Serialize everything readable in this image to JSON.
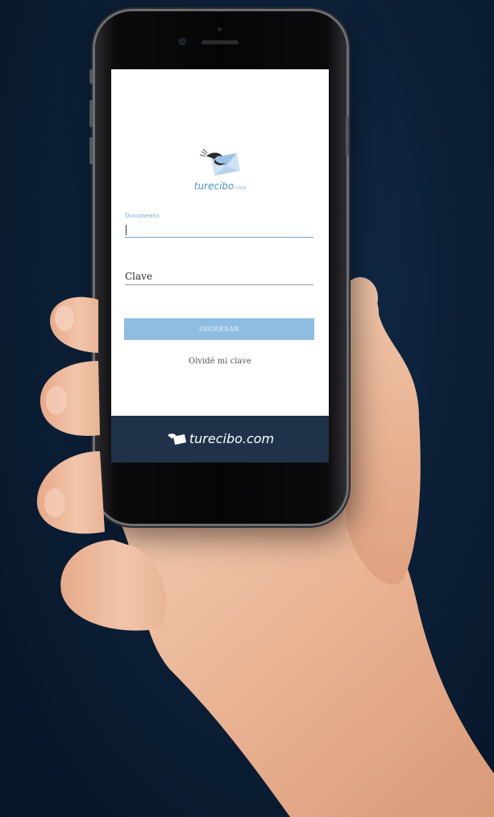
{
  "app": {
    "logo_text": "turecibo",
    "logo_suffix": ".com"
  },
  "login": {
    "document_label": "Documento",
    "password_label": "Clave",
    "submit_label": "INGRESAR",
    "forgot_label": "Olvidé mi clave"
  },
  "footer": {
    "brand": "turecibo.com"
  },
  "colors": {
    "accent": "#8fbde2",
    "brand_blue": "#4a93cf",
    "footer_bg": "#1f324a",
    "background": "#0c2038"
  },
  "icons": {
    "logo": "turecibo-bird-envelope-icon",
    "footer_logo": "turecibo-bird-envelope-icon-white"
  }
}
